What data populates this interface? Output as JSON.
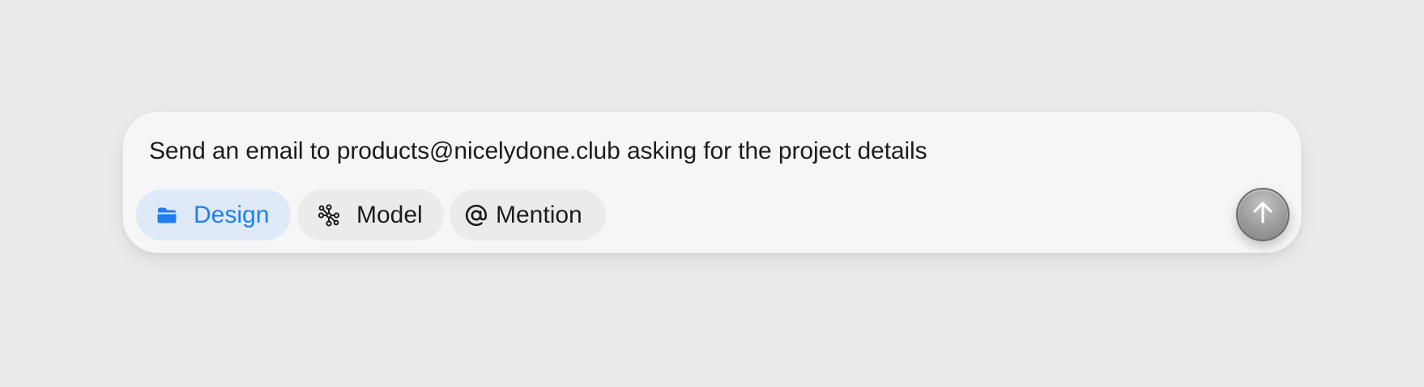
{
  "composer": {
    "prompt_text": "Send an email to products@nicelydone.club asking for the project details",
    "chips": [
      {
        "label": "Design",
        "icon": "folder-icon",
        "active": true
      },
      {
        "label": "Model",
        "icon": "model-network-icon",
        "active": false
      },
      {
        "label": "Mention",
        "icon": "at-sign-icon",
        "active": false
      }
    ],
    "send_icon": "arrow-up-icon"
  },
  "colors": {
    "page_background": "#ebebeb",
    "composer_background": "#f6f6f6",
    "accent": "#1f7ff0",
    "active_chip_background": "#dfe9f8",
    "chip_background": "#ebebeb",
    "send_button": "#a2a2a2"
  }
}
